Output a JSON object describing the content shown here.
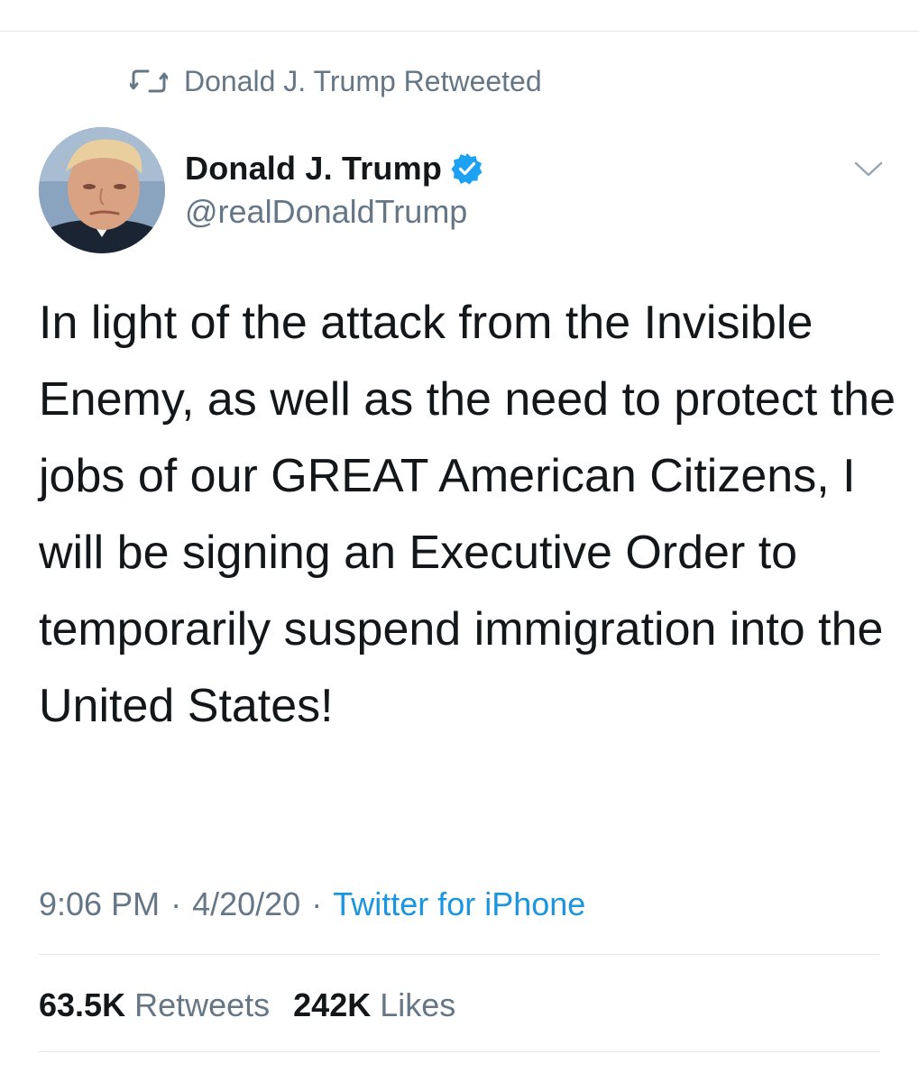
{
  "social_context": {
    "text": "Donald J. Trump Retweeted",
    "icon": "retweet-icon"
  },
  "author": {
    "display_name": "Donald J. Trump",
    "handle": "@realDonaldTrump",
    "verified": true,
    "avatar_alt": "Donald J. Trump"
  },
  "tweet": {
    "text": "In light of the attack from the Invisible Enemy, as well as the need to protect the jobs of our GREAT American Citizens, I will be signing an Executive Order to temporarily suspend immigration into the United States!",
    "time": "9:06 PM",
    "separator": "·",
    "date": "4/20/20",
    "source": "Twitter for iPhone"
  },
  "stats": {
    "retweets_count": "63.5K",
    "retweets_label": "Retweets",
    "likes_count": "242K",
    "likes_label": "Likes"
  },
  "colors": {
    "text_primary": "#14171a",
    "text_secondary": "#657786",
    "link": "#1b95e0",
    "verified": "#1da1f2",
    "divider": "#e1e8ed"
  }
}
